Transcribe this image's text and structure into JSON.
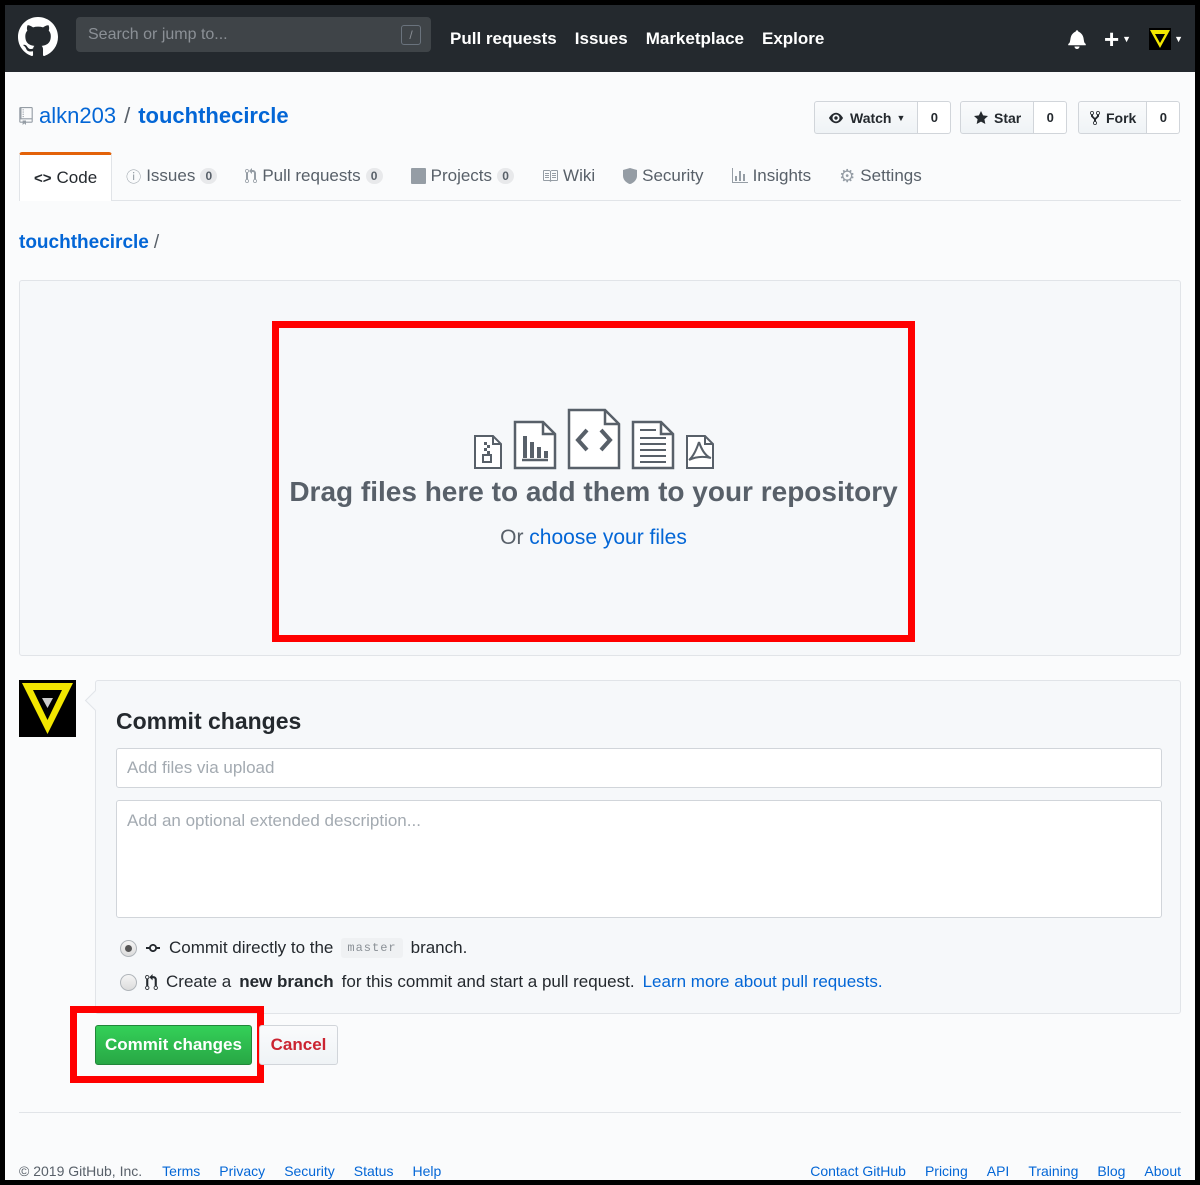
{
  "header": {
    "search_placeholder": "Search or jump to...",
    "search_shortcut": "/",
    "nav": [
      "Pull requests",
      "Issues",
      "Marketplace",
      "Explore"
    ],
    "plus": "+"
  },
  "repo": {
    "owner": "alkn203",
    "separator": "/",
    "name": "touchthecircle",
    "actions": {
      "watch_label": "Watch",
      "watch_count": "0",
      "star_label": "Star",
      "star_count": "0",
      "fork_label": "Fork",
      "fork_count": "0"
    }
  },
  "tabs": [
    {
      "label": "Code",
      "icon": "code-icon"
    },
    {
      "label": "Issues",
      "count": "0",
      "icon": "issue-icon"
    },
    {
      "label": "Pull requests",
      "count": "0",
      "icon": "pr-icon"
    },
    {
      "label": "Projects",
      "count": "0",
      "icon": "project-icon"
    },
    {
      "label": "Wiki",
      "icon": "book-icon"
    },
    {
      "label": "Security",
      "icon": "shield-icon"
    },
    {
      "label": "Insights",
      "icon": "graph-icon"
    },
    {
      "label": "Settings",
      "icon": "gear-icon"
    }
  ],
  "breadcrumb": {
    "repo": "touchthecircle",
    "sep": "/"
  },
  "dropzone": {
    "title": "Drag files here to add them to your repository",
    "or": "Or",
    "choose": "choose your files"
  },
  "commit": {
    "title": "Commit changes",
    "summary_placeholder": "Add files via upload",
    "description_placeholder": "Add an optional extended description...",
    "direct_pre": "Commit directly to the",
    "branch": "master",
    "direct_post": "branch.",
    "new_pre": "Create a",
    "new_bold": "new branch",
    "new_post": "for this commit and start a pull request.",
    "learn_more": "Learn more about pull requests.",
    "submit": "Commit changes",
    "cancel": "Cancel"
  },
  "footer": {
    "copyright": "© 2019 GitHub, Inc.",
    "left_links": [
      "Terms",
      "Privacy",
      "Security",
      "Status",
      "Help"
    ],
    "right_links": [
      "Contact GitHub",
      "Pricing",
      "API",
      "Training",
      "Blog",
      "About"
    ]
  },
  "colors": {
    "accent": "#0366d6",
    "header": "#24292e",
    "primary": "#28a745",
    "highlight": "#ff0000",
    "danger": "#cb2431"
  }
}
